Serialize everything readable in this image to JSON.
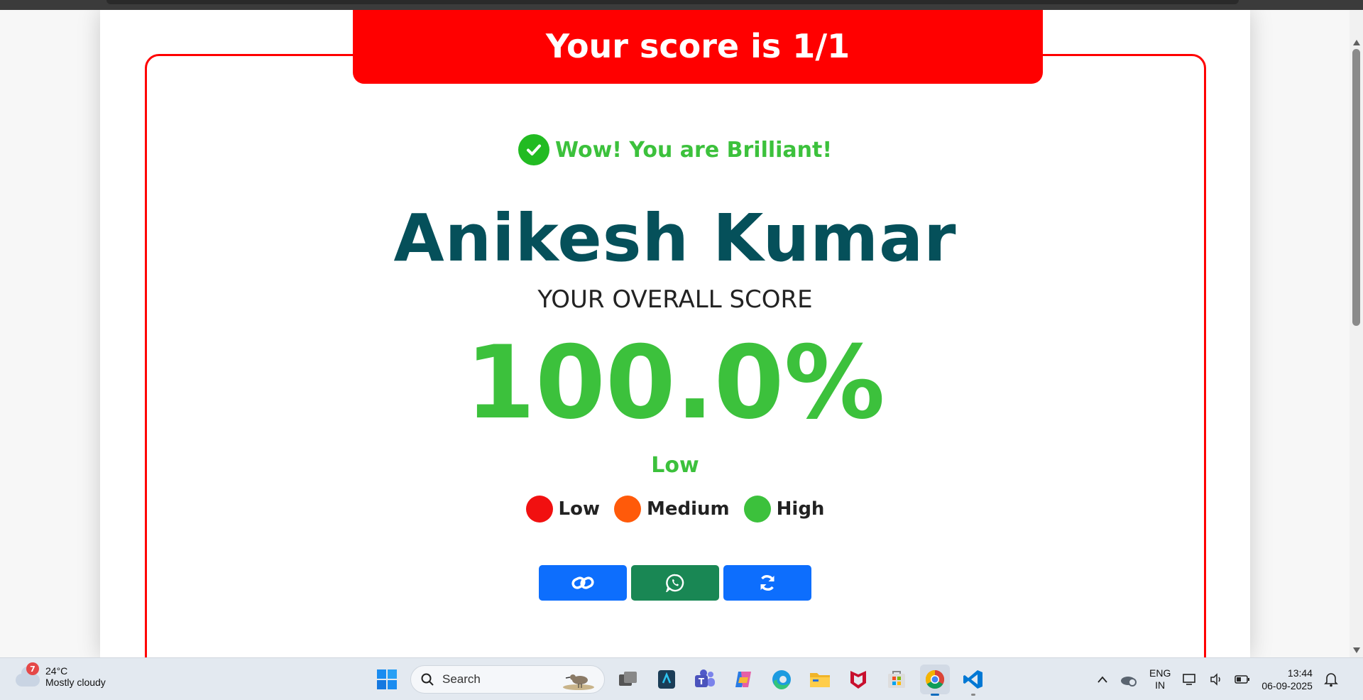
{
  "banner": {
    "title": "Your score is 1/1"
  },
  "result": {
    "message": "Wow! You are Brilliant!",
    "user_name": "Anikesh Kumar",
    "overall_label": "YOUR OVERALL SCORE",
    "percentage": "100.0%",
    "level": "Low"
  },
  "legend": [
    {
      "label": "Low",
      "color": "#f11010"
    },
    {
      "label": "Medium",
      "color": "#ff5a0a"
    },
    {
      "label": "High",
      "color": "#3cc13c"
    }
  ],
  "actions": [
    {
      "name": "copy-link",
      "icon": "link-icon",
      "color": "#0d6efd"
    },
    {
      "name": "share-whatsapp",
      "icon": "whatsapp-icon",
      "color": "#198754"
    },
    {
      "name": "retry",
      "icon": "refresh-icon",
      "color": "#0d6efd"
    }
  ],
  "colors": {
    "accent_red": "#ff0000",
    "success_green": "#3cc13c",
    "name_teal": "#05505a"
  },
  "taskbar": {
    "weather": {
      "badge": "7",
      "temperature": "24°C",
      "condition": "Mostly cloudy"
    },
    "search_placeholder": "Search",
    "apps": [
      "start-icon",
      "task-view-icon",
      "app-icon",
      "teams-icon",
      "copilot-icon",
      "edge-icon",
      "file-explorer-icon",
      "mcafee-icon",
      "store-icon",
      "chrome-icon",
      "vscode-icon"
    ],
    "language": {
      "line1": "ENG",
      "line2": "IN"
    },
    "clock": {
      "time": "13:44",
      "date": "06-09-2025"
    }
  }
}
